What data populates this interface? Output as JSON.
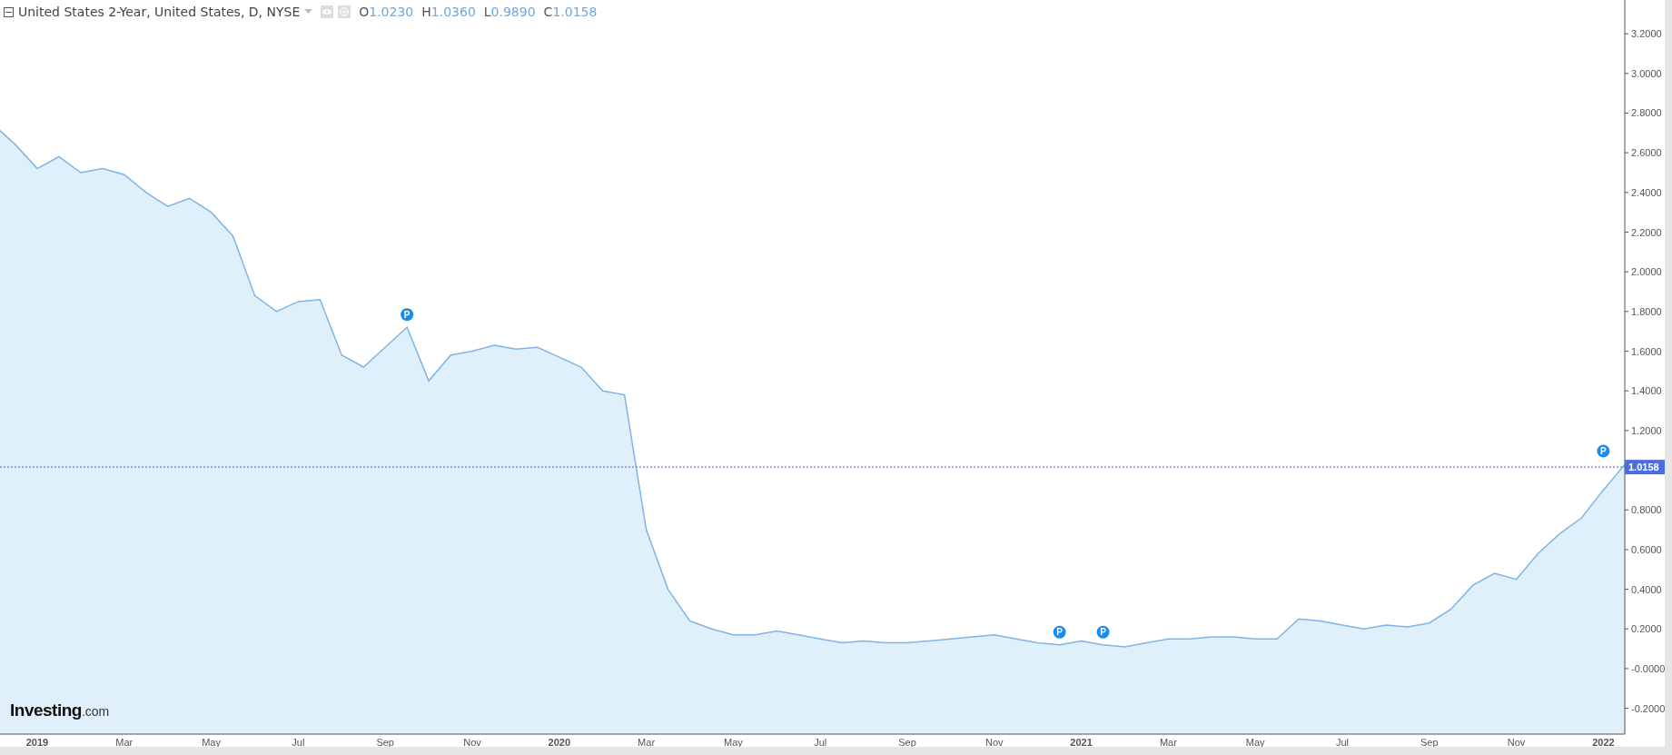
{
  "legend": {
    "title": "United States 2-Year, United States, D, NYSE",
    "ohlc": [
      {
        "label": "O",
        "value": "1.0230"
      },
      {
        "label": "H",
        "value": "1.0360"
      },
      {
        "label": "L",
        "value": "0.9890"
      },
      {
        "label": "C",
        "value": "1.0158"
      }
    ]
  },
  "event_markers": [
    {
      "label": "P"
    },
    {
      "label": "P"
    },
    {
      "label": "P"
    },
    {
      "label": "P"
    }
  ],
  "logo": {
    "name": "Investing",
    "suffix": ".com"
  },
  "chart_data": {
    "type": "area",
    "ylim": [
      -0.33,
      3.37
    ],
    "categories": [
      null,
      null,
      "2019",
      null,
      null,
      null,
      "Mar",
      null,
      null,
      null,
      "May",
      null,
      null,
      null,
      "Jul",
      null,
      null,
      null,
      "Sep",
      null,
      null,
      null,
      "Nov",
      null,
      null,
      null,
      "2020",
      null,
      null,
      null,
      "Mar",
      null,
      null,
      null,
      "May",
      null,
      null,
      null,
      "Jul",
      null,
      null,
      null,
      "Sep",
      null,
      null,
      null,
      "Nov",
      null,
      null,
      null,
      "2021",
      null,
      null,
      null,
      "Mar",
      null,
      null,
      null,
      "May",
      null,
      null,
      null,
      "Jul",
      null,
      null,
      null,
      "Sep",
      null,
      null,
      null,
      "Nov",
      null,
      null,
      null,
      "2022",
      null
    ],
    "series": [
      {
        "color": "#7eb4e6",
        "values": [
          2.74,
          2.64,
          2.52,
          2.58,
          2.5,
          2.52,
          2.49,
          2.4,
          2.33,
          2.37,
          2.3,
          2.18,
          1.88,
          1.8,
          1.85,
          1.86,
          1.58,
          1.52,
          1.62,
          1.72,
          1.45,
          1.58,
          1.6,
          1.63,
          1.61,
          1.62,
          1.57,
          1.52,
          1.4,
          1.38,
          0.7,
          0.4,
          0.24,
          0.2,
          0.17,
          0.17,
          0.19,
          0.17,
          0.15,
          0.13,
          0.14,
          0.13,
          0.13,
          0.14,
          0.15,
          0.16,
          0.17,
          0.15,
          0.13,
          0.12,
          0.14,
          0.12,
          0.11,
          0.13,
          0.15,
          0.15,
          0.16,
          0.16,
          0.15,
          0.15,
          0.25,
          0.24,
          0.22,
          0.2,
          0.22,
          0.21,
          0.23,
          0.3,
          0.42,
          0.48,
          0.45,
          0.58,
          0.68,
          0.76,
          0.9,
          1.03
        ]
      }
    ],
    "yticks": [
      {
        "value": -0.2,
        "label": "-0.2000"
      },
      {
        "value": 0,
        "label": "-0.0000"
      },
      {
        "value": 0.2,
        "label": "0.2000"
      },
      {
        "value": 0.4,
        "label": "0.4000"
      },
      {
        "value": 0.6,
        "label": "0.6000"
      },
      {
        "value": 0.8,
        "label": "0.8000"
      },
      {
        "value": 1.2,
        "label": "1.2000"
      },
      {
        "value": 1.4,
        "label": "1.4000"
      },
      {
        "value": 1.6,
        "label": "1.6000"
      },
      {
        "value": 1.8,
        "label": "1.8000"
      },
      {
        "value": 2.0,
        "label": "2.0000"
      },
      {
        "value": 2.2,
        "label": "2.2000"
      },
      {
        "value": 2.4,
        "label": "2.4000"
      },
      {
        "value": 2.6,
        "label": "2.6000"
      },
      {
        "value": 2.8,
        "label": "2.8000"
      },
      {
        "value": 3.0,
        "label": "3.0000"
      },
      {
        "value": 3.2,
        "label": "3.2000"
      }
    ],
    "ref_lines": [
      {
        "axis": "y",
        "value": 1.0158,
        "label": "1.0158"
      }
    ]
  }
}
